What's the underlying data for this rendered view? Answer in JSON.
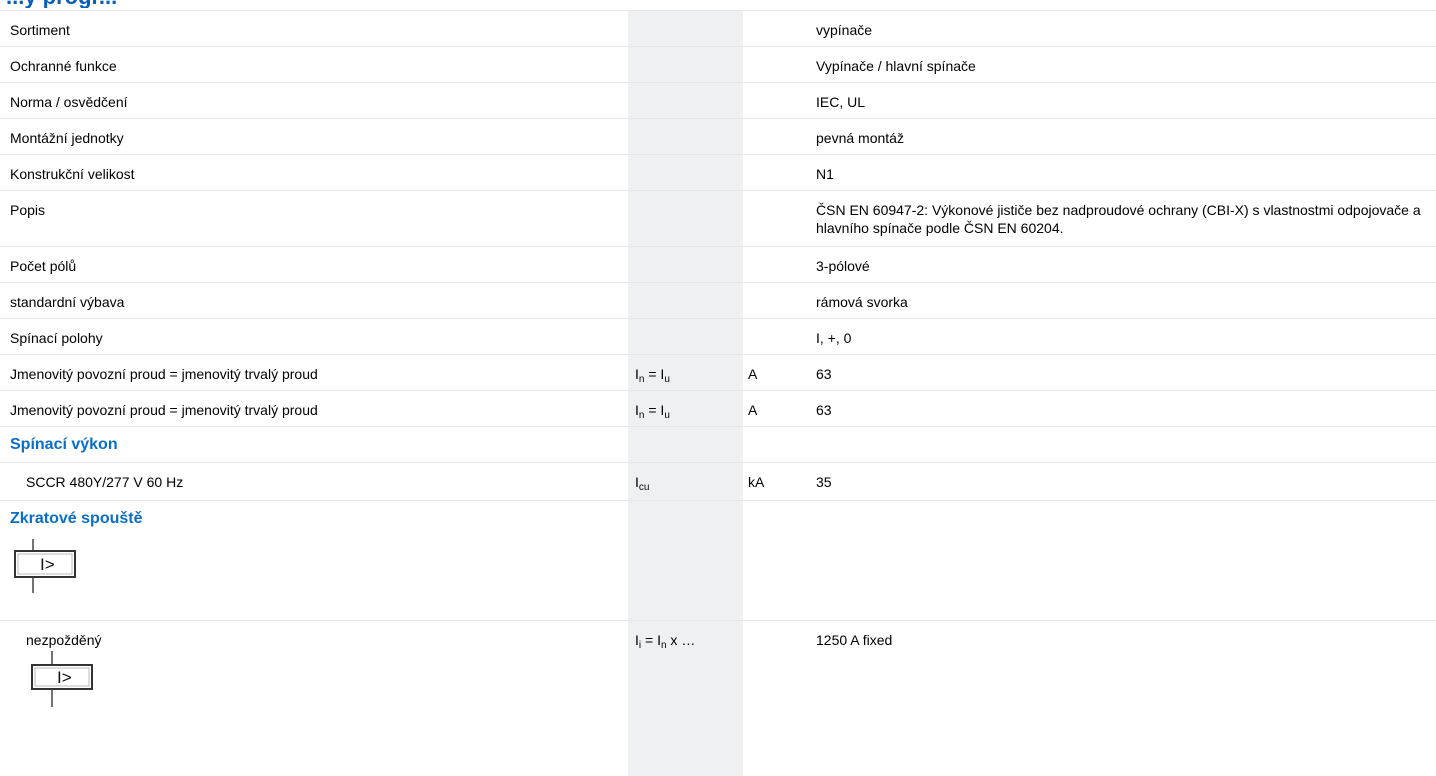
{
  "page": {
    "partial_heading": "...ý progr..."
  },
  "rows": [
    {
      "label": "Sortiment",
      "value": "vypínače"
    },
    {
      "label": "Ochranné funkce",
      "value": "Vypínače / hlavní spínače"
    },
    {
      "label": "Norma / osvědčení",
      "value": "IEC, UL"
    },
    {
      "label": "Montážní jednotky",
      "value": "pevná montáž"
    },
    {
      "label": "Konstrukční velikost",
      "value": "N1"
    },
    {
      "label": "Popis",
      "value": "ČSN EN 60947-2: Výkonové jističe bez nadproudové ochrany (CBI-X) s vlastnostmi odpojovače a hlavního spínače podle ČSN EN 60204."
    },
    {
      "label": "Počet pólů",
      "value": "3-pólové"
    },
    {
      "label": "standardní výbava",
      "value": "rámová svorka"
    },
    {
      "label": "Spínací polohy",
      "value": "I, +, 0"
    },
    {
      "label": "Jmenovitý povozní proud = jmenovitý trvalý proud",
      "sym_a": "I",
      "sym_a_sub": "n",
      "sym_mid": " = I",
      "sym_b_sub": "u",
      "unit": "A",
      "value": "63"
    },
    {
      "label": "Jmenovitý povozní proud = jmenovitý trvalý proud",
      "sym_a": "I",
      "sym_a_sub": "n",
      "sym_mid": " = I",
      "sym_b_sub": "u",
      "unit": "A",
      "value": "63"
    }
  ],
  "switching": {
    "title": "Spínací výkon",
    "row": {
      "label": "SCCR 480Y/277 V 60 Hz",
      "sym": "I",
      "sym_sub": "cu",
      "unit": "kA",
      "value": "35"
    }
  },
  "short_circuit": {
    "title": "Zkratové spouště",
    "icon_symbol": "I>",
    "row": {
      "label": "nezpožděný",
      "sym": "I",
      "sym_sub": "i",
      "sym_mid": " = I",
      "sym_sub2": "n",
      "sym_tail": " x …",
      "value": "1250 A fixed",
      "icon_symbol": "I>"
    }
  },
  "icons": {
    "relay": "overcurrent-release-icon"
  },
  "colors": {
    "section_title": "#0a6ec2",
    "band": "#eef0f2",
    "row_border": "#e4e6e8"
  }
}
